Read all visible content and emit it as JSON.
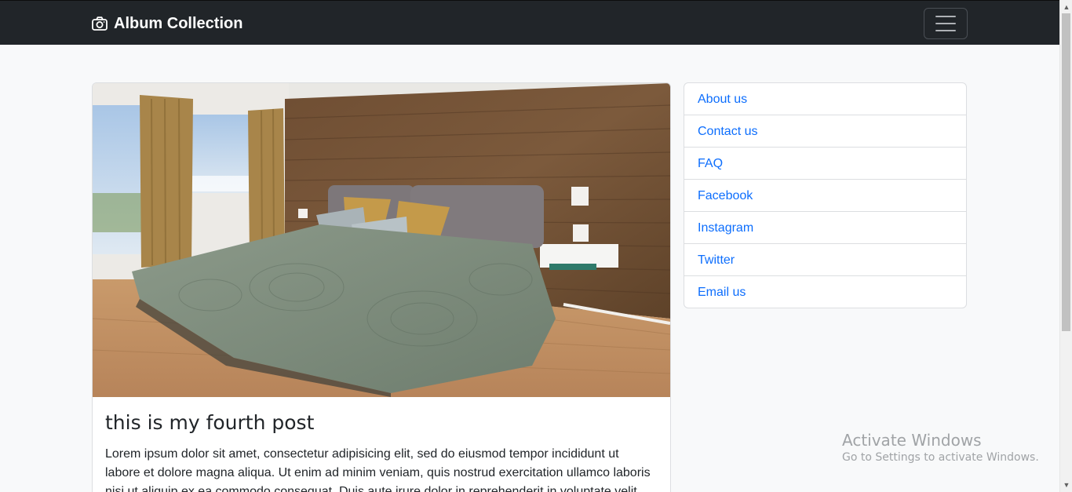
{
  "navbar": {
    "brand_label": "Album Collection",
    "brand_icon": "camera-icon",
    "toggler_icon": "hamburger-menu-icon"
  },
  "post": {
    "image_description_icon": "bedroom-photo",
    "title": "this is my fourth post",
    "text": "Lorem ipsum dolor sit amet, consectetur adipisicing elit, sed do eiusmod tempor incididunt ut labore et dolore magna aliqua. Ut enim ad minim veniam, quis nostrud exercitation ullamco laboris nisi ut aliquip ex ea commodo consequat. Duis aute irure dolor in reprehenderit in voluptate velit"
  },
  "sidebar": {
    "items": [
      {
        "label": "About us"
      },
      {
        "label": "Contact us"
      },
      {
        "label": "FAQ"
      },
      {
        "label": "Facebook"
      },
      {
        "label": "Instagram"
      },
      {
        "label": "Twitter"
      },
      {
        "label": "Email us"
      }
    ]
  },
  "watermark": {
    "title": "Activate Windows",
    "subtitle": "Go to Settings to activate Windows."
  },
  "colors": {
    "navbar_bg": "#212529",
    "link": "#0d6efd",
    "page_bg": "#f8f9fa"
  }
}
